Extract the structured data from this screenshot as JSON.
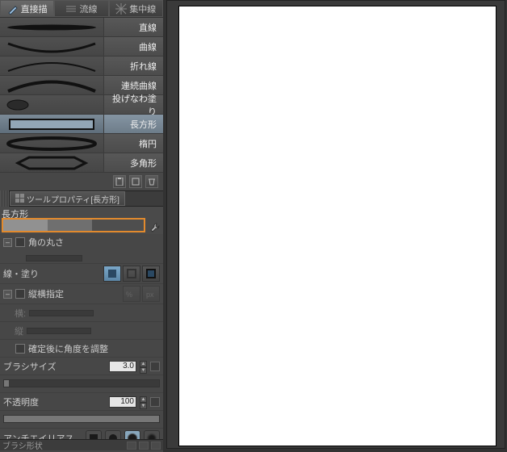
{
  "tabs": [
    {
      "label": "直接描",
      "active": true
    },
    {
      "label": "流線",
      "active": false
    },
    {
      "label": "集中線",
      "active": false
    }
  ],
  "tools": [
    {
      "label": "直線",
      "shape": "stroke-flat"
    },
    {
      "label": "曲線",
      "shape": "arc-down"
    },
    {
      "label": "折れ線",
      "shape": "arc-up-thin"
    },
    {
      "label": "連続曲線",
      "shape": "arc-up-thick"
    },
    {
      "label": "投げなわ塗り",
      "shape": "blob"
    },
    {
      "label": "長方形",
      "shape": "rect",
      "selected": true
    },
    {
      "label": "楕円",
      "shape": "ellipse"
    },
    {
      "label": "多角形",
      "shape": "hex"
    }
  ],
  "prop_tab": "ツールプロパティ[長方形]",
  "subtool_name": "長方形",
  "props": {
    "corner_radius": "角の丸さ",
    "line_fill": "線・塗り",
    "aspect_lock": "縦横指定",
    "width": "横:",
    "height": "縦",
    "adjust_angle": "確定後に角度を調整",
    "brush_size_label": "ブラシサイズ",
    "brush_size_value": "3.0",
    "opacity_label": "不透明度",
    "opacity_value": "100",
    "antialias": "アンチエイリアス",
    "brush_shape": "ブラシ形状"
  }
}
